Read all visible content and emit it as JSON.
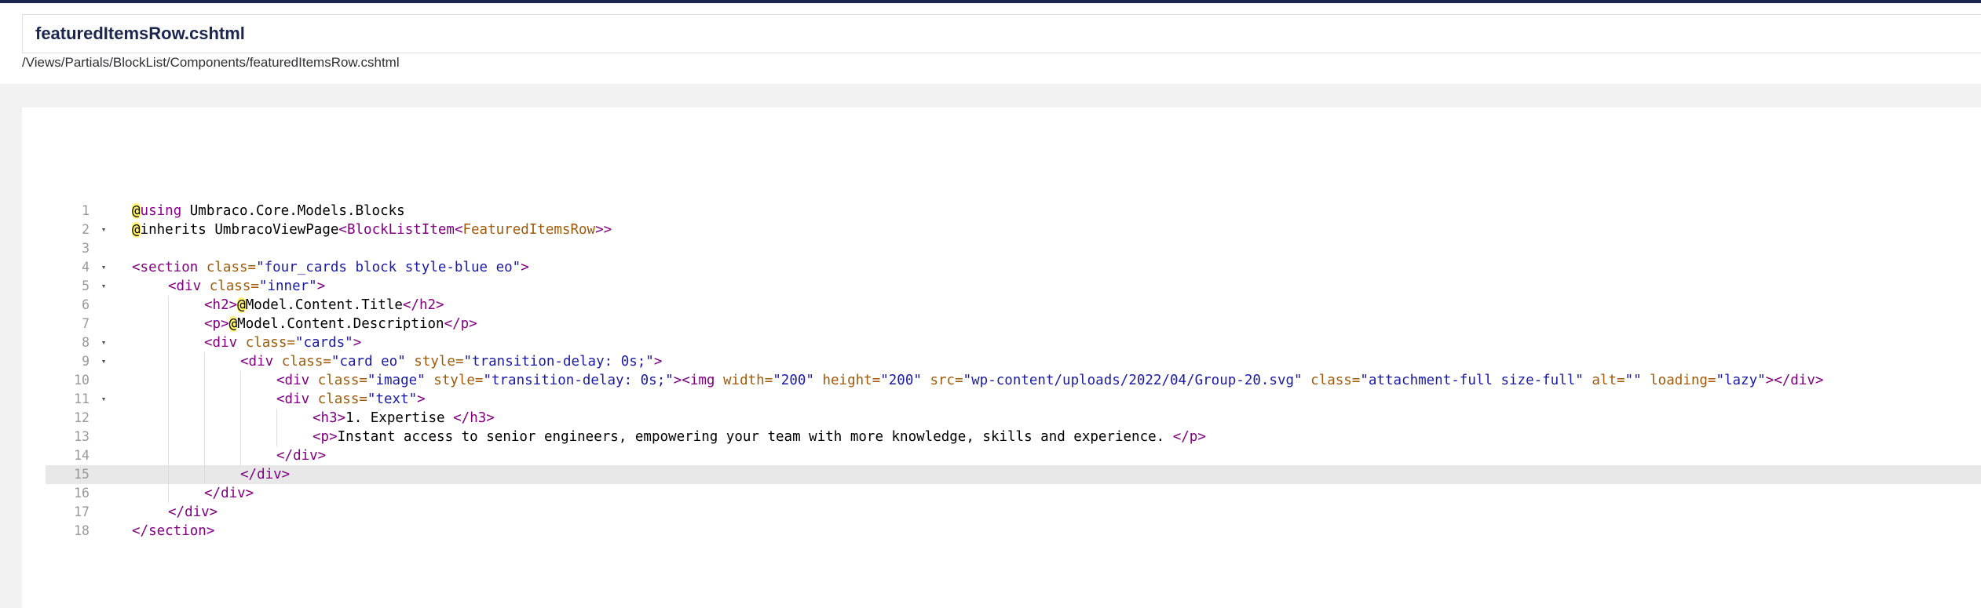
{
  "header": {
    "file_name": "featuredItemsRow.cshtml",
    "file_path": "/Views/Partials/BlockList/Components/featuredItemsRow.cshtml"
  },
  "editor": {
    "active_line": 15,
    "lines": [
      {
        "n": "1",
        "fold": false,
        "indent": 0
      },
      {
        "n": "2",
        "fold": true,
        "indent": 0
      },
      {
        "n": "3",
        "fold": false,
        "indent": 0
      },
      {
        "n": "4",
        "fold": true,
        "indent": 0
      },
      {
        "n": "5",
        "fold": true,
        "indent": 1
      },
      {
        "n": "6",
        "fold": false,
        "indent": 2
      },
      {
        "n": "7",
        "fold": false,
        "indent": 2
      },
      {
        "n": "8",
        "fold": true,
        "indent": 2
      },
      {
        "n": "9",
        "fold": true,
        "indent": 3
      },
      {
        "n": "10",
        "fold": false,
        "indent": 4
      },
      {
        "n": "11",
        "fold": true,
        "indent": 4
      },
      {
        "n": "12",
        "fold": false,
        "indent": 5
      },
      {
        "n": "13",
        "fold": false,
        "indent": 5
      },
      {
        "n": "14",
        "fold": false,
        "indent": 4
      },
      {
        "n": "15",
        "fold": false,
        "indent": 3
      },
      {
        "n": "16",
        "fold": false,
        "indent": 2
      },
      {
        "n": "17",
        "fold": false,
        "indent": 1
      },
      {
        "n": "18",
        "fold": false,
        "indent": 0
      }
    ],
    "code": {
      "l1": {
        "at": "@",
        "kw": "using",
        "rest": " Umbraco.Core.Models.Blocks"
      },
      "l2": {
        "at": "@",
        "kw": "inherits",
        "rest": " UmbracoViewPage",
        "lt": "<",
        "g1": "BlockListItem",
        "lt2": "<",
        "g2": "FeaturedItemsRow",
        "gt": ">>"
      },
      "l4": {
        "open": "<section",
        "attr": " class=",
        "val": "\"four_cards block style-blue eo\"",
        "close": ">"
      },
      "l5": {
        "open": "<div",
        "attr": " class=",
        "val": "\"inner\"",
        "close": ">"
      },
      "l6": {
        "open": "<h2>",
        "at": "@",
        "body": "Model.Content.Title",
        "close": "</h2>"
      },
      "l7": {
        "open": "<p>",
        "at": "@",
        "body": "Model.Content.Description",
        "close": "</p>"
      },
      "l8": {
        "open": "<div",
        "attr": " class=",
        "val": "\"cards\"",
        "close": ">"
      },
      "l9": {
        "open": "<div",
        "attr1": " class=",
        "val1": "\"card eo\"",
        "attr2": " style=",
        "val2": "\"transition-delay: 0s;\"",
        "close": ">"
      },
      "l10": {
        "open": "<div",
        "attr1": " class=",
        "val1": "\"image\"",
        "attr2": " style=",
        "val2": "\"transition-delay: 0s;\"",
        "gt": ">",
        "img": "<img",
        "a_w": " width=",
        "v_w": "\"200\"",
        "a_h": " height=",
        "v_h": "\"200\"",
        "a_src": " src=",
        "v_src": "\"wp-content/uploads/2022/04/Group-20.svg\"",
        "a_cls": " class=",
        "v_cls": "\"attachment-full size-full\"",
        "a_alt": " alt=",
        "v_alt": "\"\"",
        "a_load": " loading=",
        "v_load": "\"lazy\"",
        "end": "></div>"
      },
      "l11": {
        "open": "<div",
        "attr": " class=",
        "val": "\"text\"",
        "close": ">"
      },
      "l12": {
        "open": "<h3>",
        "body": "1. Expertise ",
        "close": "</h3>"
      },
      "l13": {
        "open": "<p>",
        "body": "Instant access to senior engineers, empowering your team with more knowledge, skills and experience. ",
        "close": "</p>"
      },
      "l14": {
        "close": "</div>"
      },
      "l15": {
        "close": "</div>"
      },
      "l16": {
        "close": "</div>"
      },
      "l17": {
        "close": "</div>"
      },
      "l18": {
        "close": "</section>"
      }
    }
  },
  "colors": {
    "topbar": "#1b264f",
    "tag": "#800080",
    "attribute": "#a05a0a",
    "string": "#1a1aa6",
    "razor_highlight": "#fff36b",
    "active_line": "#e8e8e8"
  }
}
